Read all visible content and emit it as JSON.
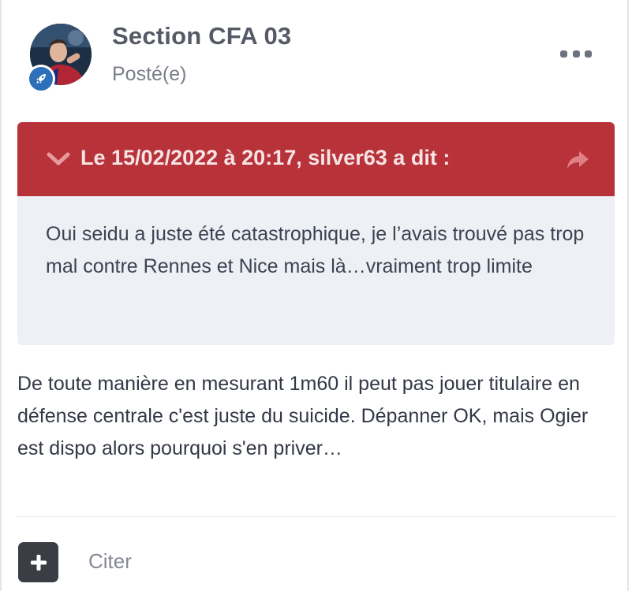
{
  "post": {
    "author": "Section CFA 03",
    "status": "Posté(e)",
    "menu_icon": "ellipsis-icon",
    "avatar_icon": "user-avatar",
    "badge_icon": "rocket-icon",
    "badge_color": "#2d6fb8"
  },
  "quote": {
    "citation": "Le 15/02/2022 à 20:17, silver63 a dit :",
    "text": "Oui seidu a juste été catastrophique, je l’avais trouvé pas trop mal contre Rennes et Nice mais là…vraiment trop limite",
    "toggle_icon": "chevron-down-icon",
    "share_icon": "share-arrow-icon",
    "header_color": "#b8323a",
    "body_color": "#edf0f5"
  },
  "body": {
    "text": "De toute manière en mesurant 1m60 il peut pas jouer titulaire en défense centrale c'est juste du suicide. Dépanner OK, mais Ogier est dispo alors pourquoi s'en priver…"
  },
  "actions": {
    "add_icon": "plus-icon",
    "quote_label": "Citer"
  }
}
